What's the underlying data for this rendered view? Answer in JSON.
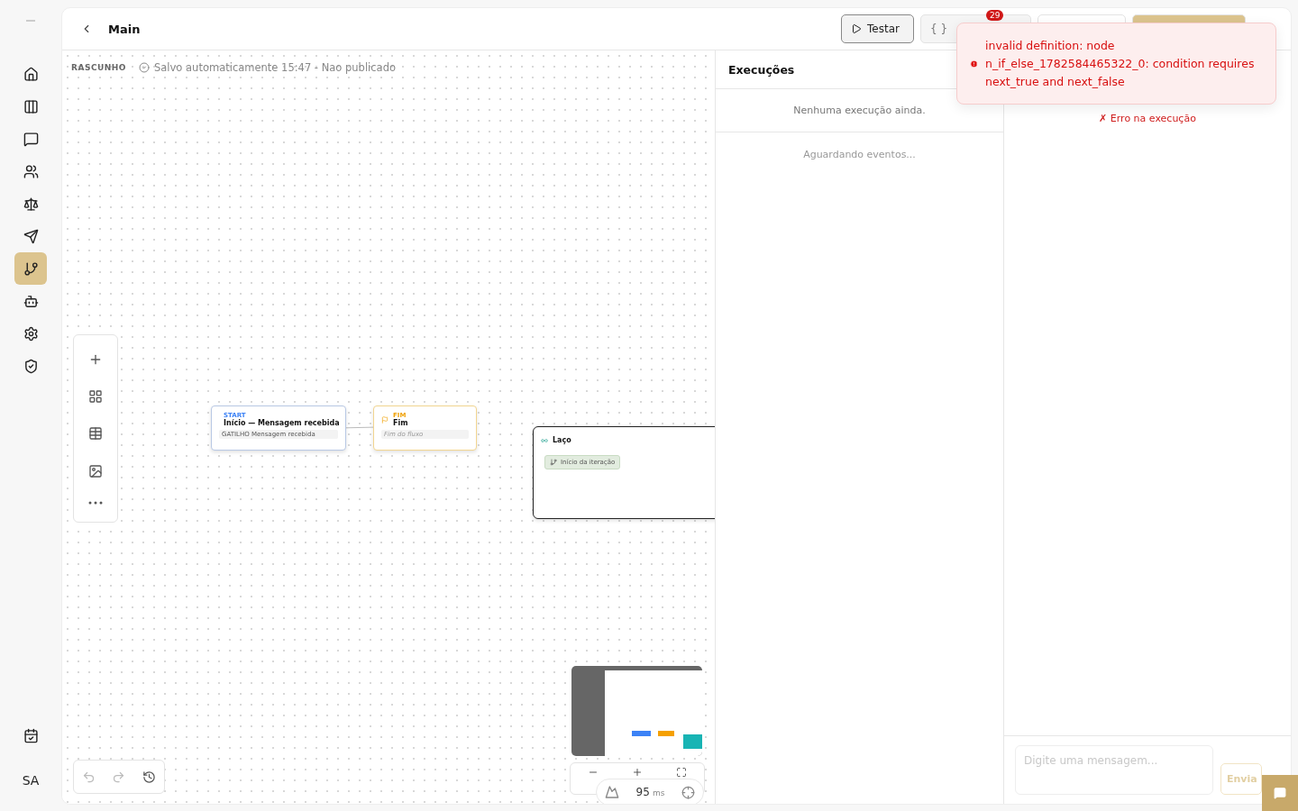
{
  "sidebar": {
    "items": [
      {
        "selected": false
      },
      {
        "selected": false
      },
      {
        "selected": false
      },
      {
        "selected": false
      },
      {
        "selected": false
      },
      {
        "selected": false
      },
      {
        "selected": true
      },
      {
        "selected": false
      },
      {
        "selected": false
      },
      {
        "selected": false
      }
    ],
    "bottom_avatar": "SA"
  },
  "header": {
    "title": "Main",
    "buttons": [
      {
        "kind": "test",
        "label": "Testar"
      },
      {
        "kind": "json",
        "label": "{ }",
        "badge": "29"
      },
      {
        "kind": "plain"
      },
      {
        "kind": "primary"
      }
    ]
  },
  "canvas": {
    "status": "RASCUNHO",
    "save_note": "Salvo automaticamente 15:47 - Nao publicado",
    "nodes": [
      {
        "kind": "start",
        "tag": "START",
        "title": "Início — Mensagem recebida",
        "detail_label": "GATILHO",
        "detail": "Mensagem recebida"
      },
      {
        "kind": "end",
        "tag": "FIM",
        "title": "Fim",
        "detail": "Fim do fluxo"
      },
      {
        "kind": "loop",
        "title": "Laço",
        "child": "Início da iteração"
      }
    ],
    "perf": {
      "value": "95",
      "unit": "ms"
    }
  },
  "executions": {
    "title": "Execuções",
    "empty": "Nenhuma execução ainda.",
    "waiting": "Aguardando eventos..."
  },
  "test_panel": {
    "error": "✗ Erro na execução",
    "input": {
      "placeholder": "Digite uma mensagem..."
    },
    "send": "Envia"
  },
  "toast": {
    "message": "invalid definition: node n_if_else_1782584465322_0: condition requires next_true and next_false"
  }
}
